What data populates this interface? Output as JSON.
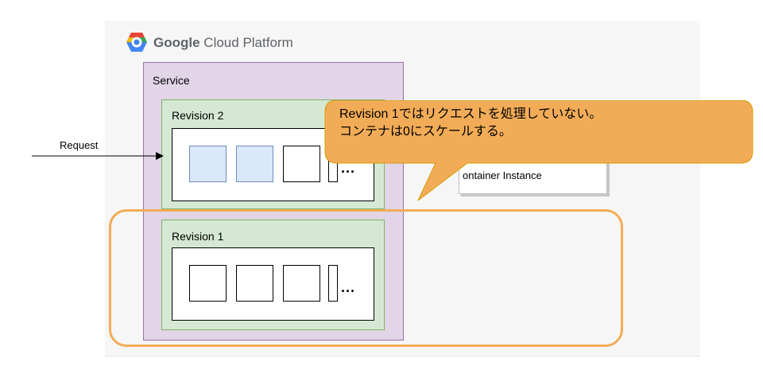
{
  "platform": {
    "brand": "Google",
    "product": "Cloud Platform",
    "icon": "google-cloud-logo-icon"
  },
  "diagram": {
    "service_label": "Service",
    "request_label": "Request",
    "revisions": [
      {
        "label": "Revision 2",
        "instances": [
          "active",
          "active",
          "idle"
        ],
        "more": "..."
      },
      {
        "label": "Revision 1",
        "instances": [
          "idle",
          "idle",
          "idle"
        ],
        "more": "..."
      }
    ],
    "container_instance_label": "ontainer Instance",
    "callout": {
      "line1": "Revision 1ではリクエストを処理していない。",
      "line2": "コンテナは0にスケールする。"
    }
  },
  "colors": {
    "service_fill": "#e1d5e7",
    "revision_fill": "#d5e8d4",
    "active_instance_fill": "#dae8fc",
    "callout_fill": "#f2ac57",
    "highlight_stroke": "#f2ac57"
  }
}
